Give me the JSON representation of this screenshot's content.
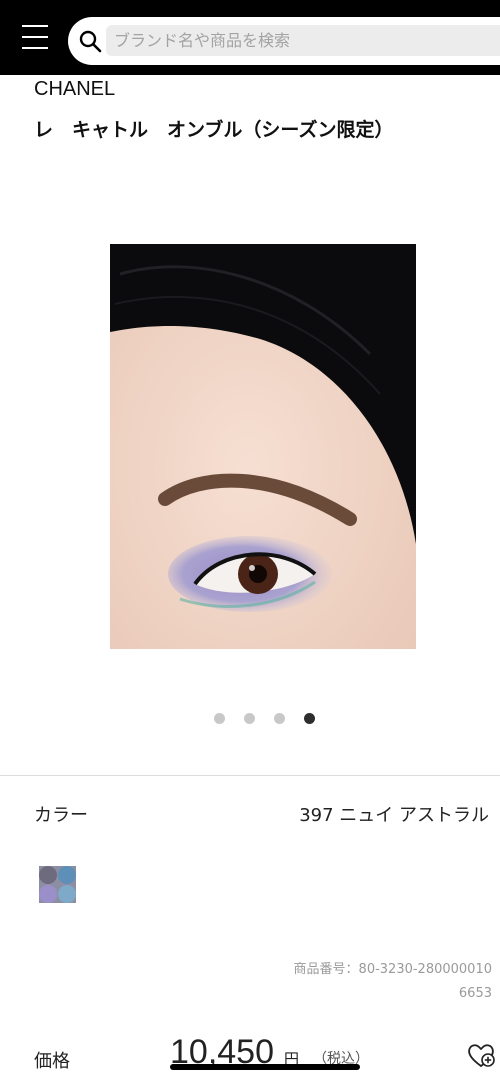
{
  "header": {
    "search_placeholder": "ブランド名や商品を検索"
  },
  "product": {
    "brand": "CHANEL",
    "name": "レ　キャトル　オンブル（シーズン限定）",
    "image_slides": 4,
    "active_slide": 4,
    "color_label": "カラー",
    "color_value": "397 ニュイ アストラル",
    "product_code": "商品番号：80-3230-2800000106653",
    "price_label": "価格",
    "price_value": "10,450",
    "price_unit": "円",
    "price_tax": "（税込）"
  },
  "icons": {
    "menu": "menu-icon",
    "search": "search-icon",
    "wishlist": "heart-plus-icon"
  }
}
